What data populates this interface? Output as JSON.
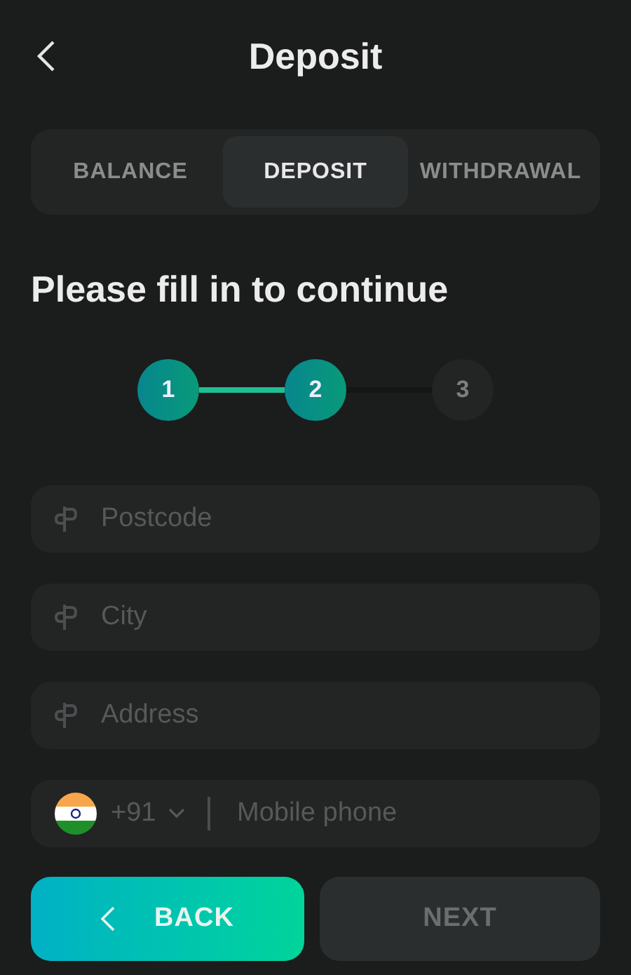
{
  "header": {
    "title": "Deposit"
  },
  "tabs": [
    {
      "label": "BALANCE",
      "selected": false
    },
    {
      "label": "DEPOSIT",
      "selected": true
    },
    {
      "label": "WITHDRAWAL",
      "selected": false
    }
  ],
  "heading": "Please fill in to continue",
  "steps": [
    {
      "label": "1",
      "completed": true
    },
    {
      "label": "2",
      "completed": true
    },
    {
      "label": "3",
      "completed": false
    }
  ],
  "fields": [
    {
      "kind": "text",
      "placeholder": "Postcode"
    },
    {
      "kind": "text",
      "placeholder": "City"
    },
    {
      "kind": "text",
      "placeholder": "Address"
    },
    {
      "kind": "phone",
      "code": "+91",
      "placeholder": "Mobile phone"
    }
  ],
  "buttons": [
    {
      "label": "BACK",
      "disabled": false
    },
    {
      "label": "NEXT",
      "disabled": true
    }
  ]
}
